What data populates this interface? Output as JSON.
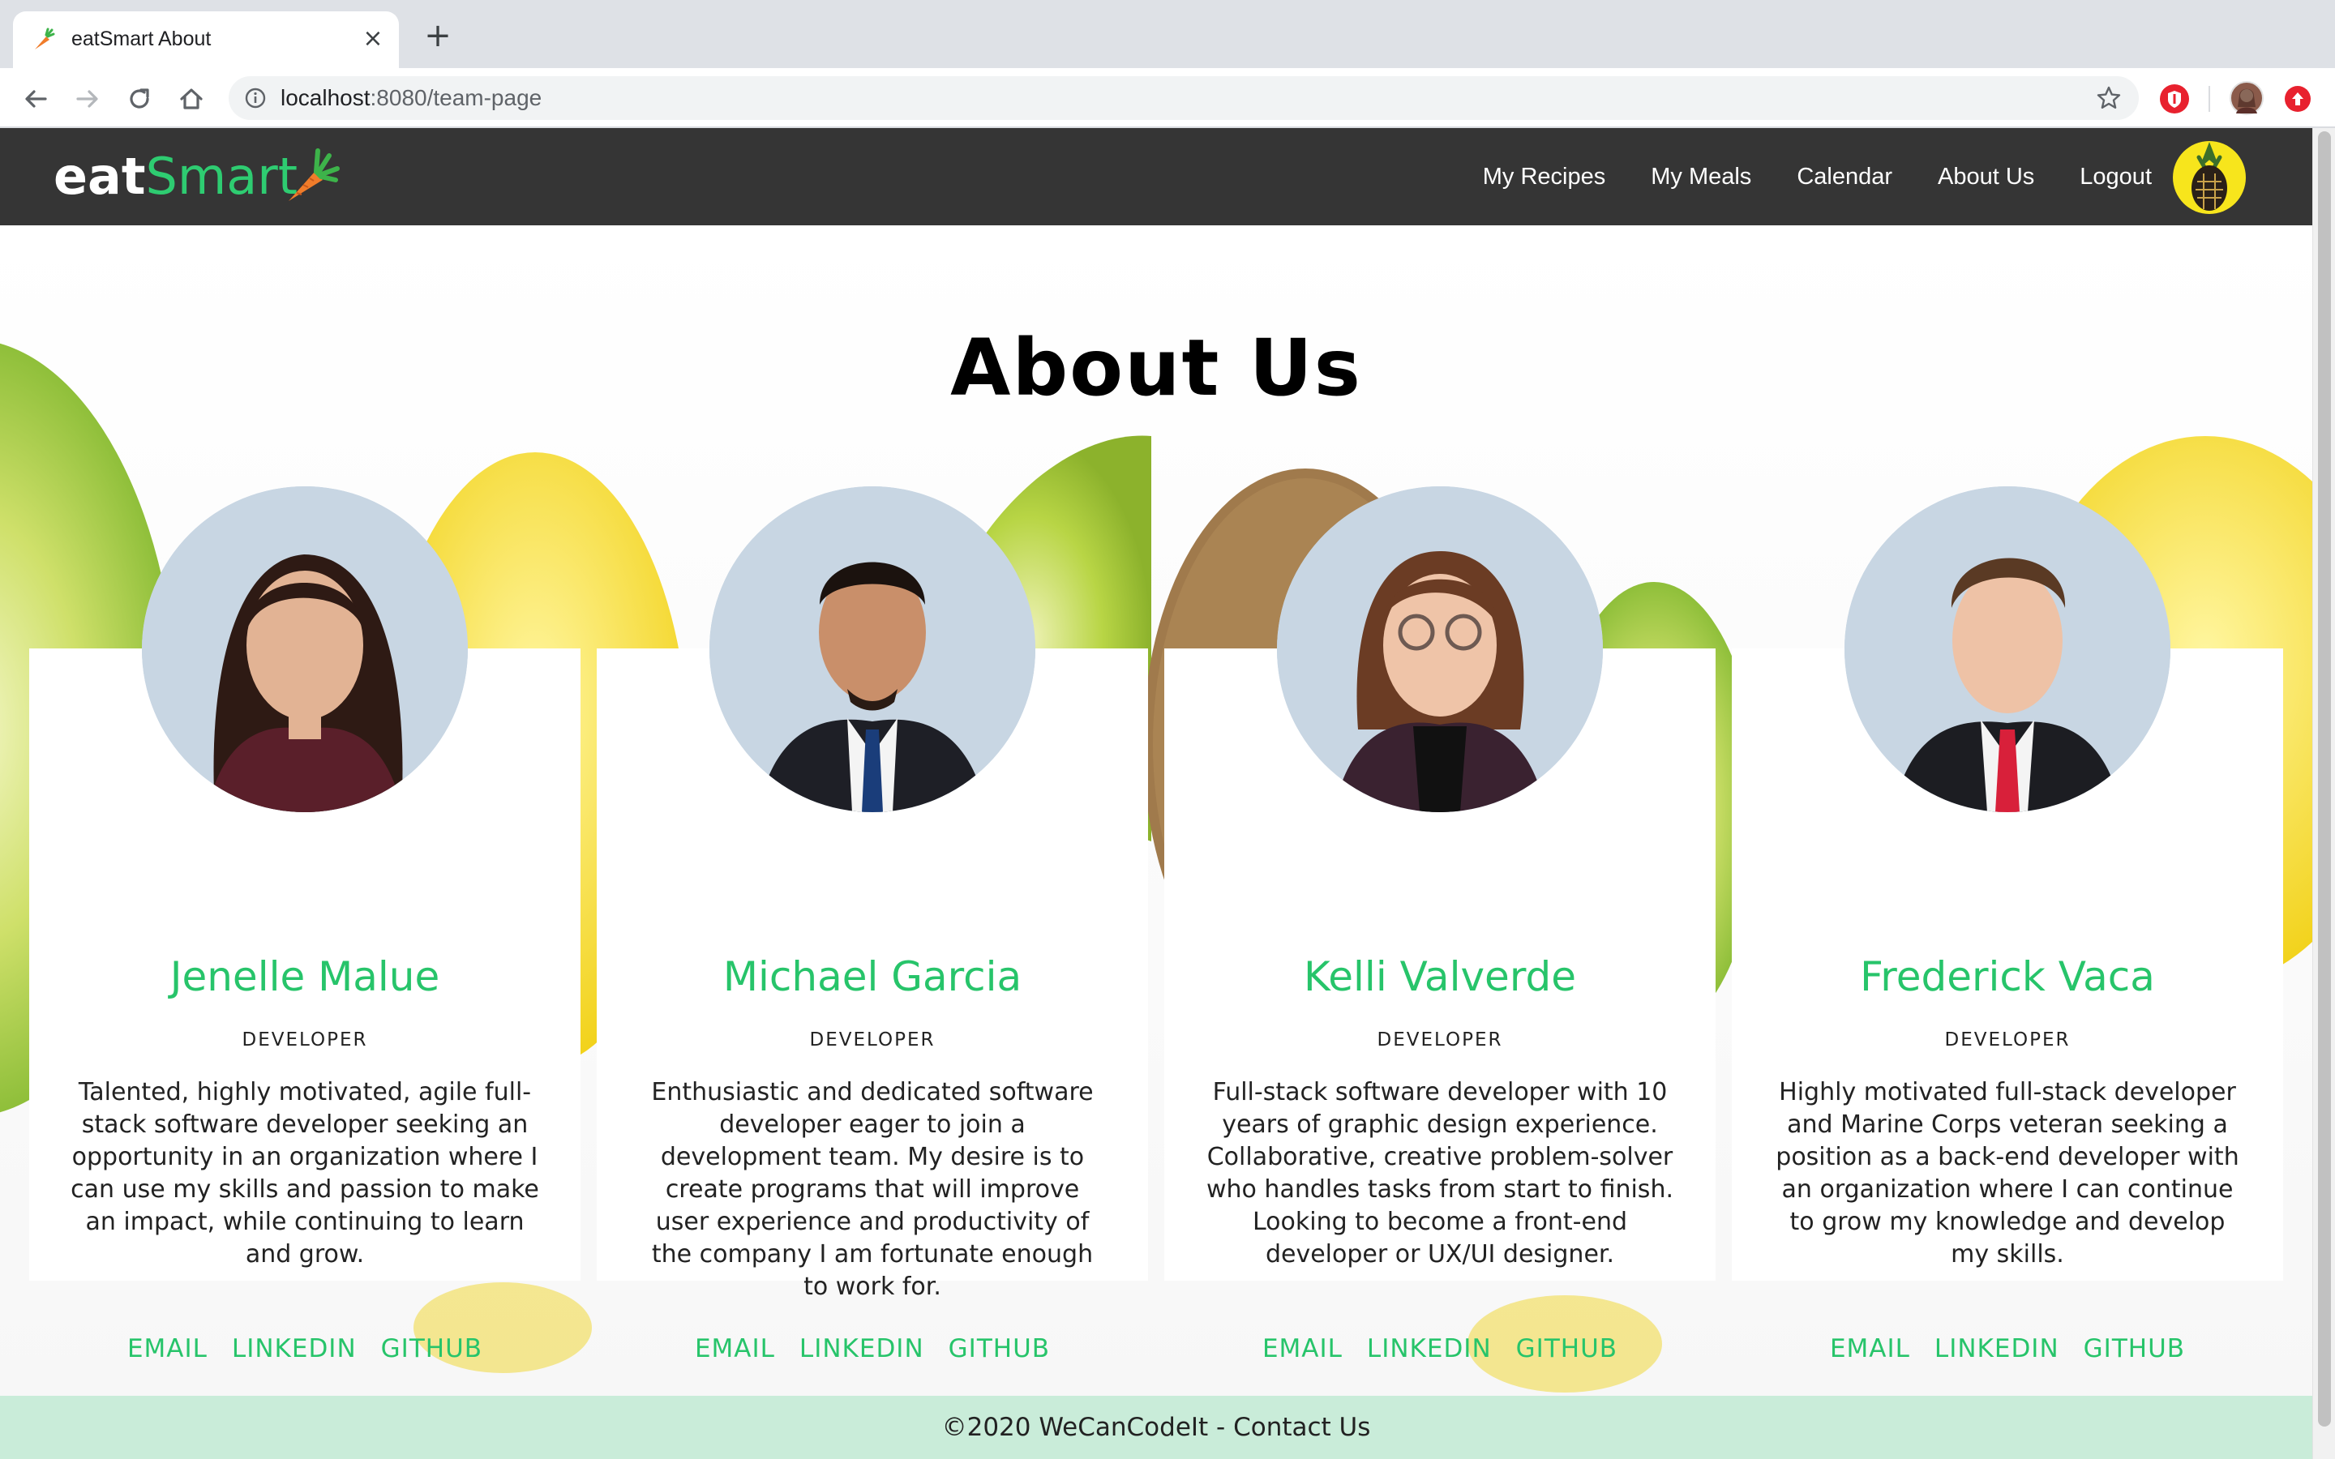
{
  "browser": {
    "tab_title": "eatSmart About",
    "tab_close": "×",
    "new_tab": "+",
    "url_host": "localhost",
    "url_path": ":8080/team-page"
  },
  "navbar": {
    "logo_eat": "eat",
    "logo_smart": "Smart",
    "links": [
      "My Recipes",
      "My Meals",
      "Calendar",
      "About Us",
      "Logout"
    ]
  },
  "page": {
    "title": "About Us"
  },
  "team": [
    {
      "name": "Jenelle Malue",
      "role": "DEVELOPER",
      "bio": "Talented, highly motivated, agile full-stack software developer seeking an opportunity in an organization where I can use my skills and passion to make an impact, while continuing to learn and grow.",
      "links": [
        "EMAIL",
        "LINKEDIN",
        "GITHUB"
      ]
    },
    {
      "name": "Michael Garcia",
      "role": "DEVELOPER",
      "bio": "Enthusiastic and dedicated software developer eager to join a development team. My desire is to create programs that will improve user experience and productivity of the company I am fortunate enough to work for.",
      "links": [
        "EMAIL",
        "LINKEDIN",
        "GITHUB"
      ]
    },
    {
      "name": "Kelli Valverde",
      "role": "DEVELOPER",
      "bio": "Full-stack software developer with 10 years of graphic design experience. Collaborative, creative problem-solver who handles tasks from start to finish. Looking to become a front-end developer or UX/UI designer.",
      "links": [
        "EMAIL",
        "LINKEDIN",
        "GITHUB"
      ]
    },
    {
      "name": "Frederick Vaca",
      "role": "DEVELOPER",
      "bio": "Highly motivated full-stack developer and Marine Corps veteran seeking a position as a back-end developer with an organization where I can continue to grow my knowledge and develop my skills.",
      "links": [
        "EMAIL",
        "LINKEDIN",
        "GITHUB"
      ]
    }
  ],
  "footer": {
    "text": "©2020 WeCanCodeIt - Contact Us"
  },
  "colors": {
    "navbar_bg": "#353535",
    "accent_green": "#27c46a",
    "footer_bg": "#c9ecd9"
  }
}
